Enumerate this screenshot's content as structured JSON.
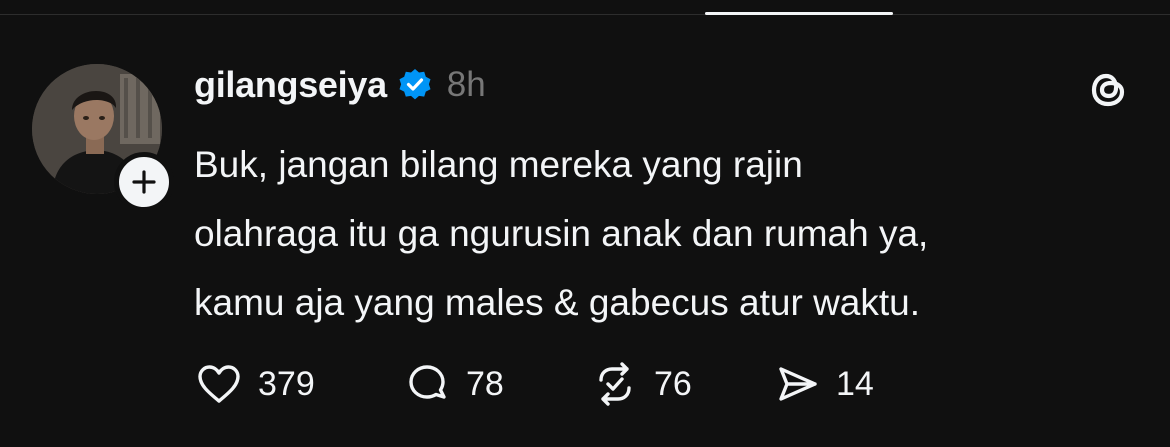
{
  "post": {
    "author": {
      "username": "gilangseiya",
      "verified": true,
      "avatar_icon": "profile-photo"
    },
    "timestamp": "8h",
    "text_lines": [
      "Buk, jangan bilang mereka yang rajin",
      "olahraga itu ga ngurusin anak dan rumah ya,",
      "kamu aja yang males & gabecus atur waktu."
    ],
    "stats": {
      "likes": "379",
      "replies": "78",
      "reposts": "76",
      "shares": "14"
    }
  },
  "icons": {
    "like": "heart-icon",
    "reply": "speech-bubble-icon",
    "repost": "repost-icon",
    "share": "send-icon",
    "follow": "plus-icon",
    "verified": "verified-badge-icon",
    "app_logo": "threads-logo-icon"
  },
  "colors": {
    "background": "#101010",
    "text": "#f3f5f7",
    "muted": "#777777",
    "verified": "#0095f6"
  }
}
